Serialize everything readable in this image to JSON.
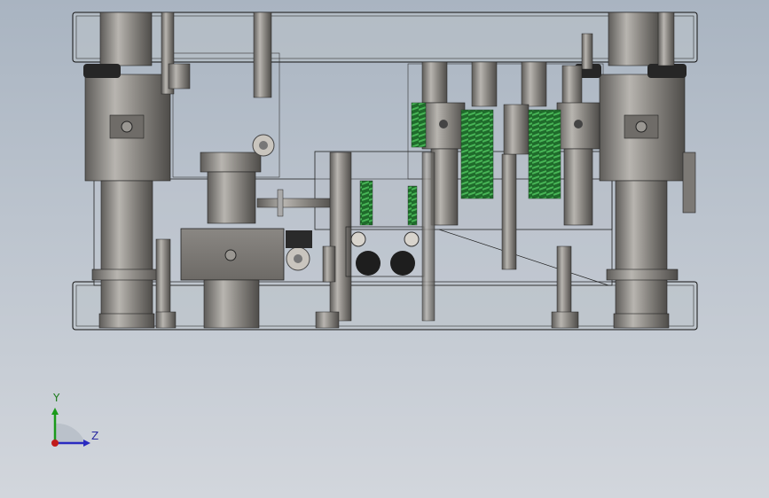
{
  "viewport": {
    "background_top": "#a9b4c1",
    "background_bottom": "#d2d6dc"
  },
  "triad": {
    "y_label": "Y",
    "z_label": "Z",
    "y_color": "#1a9a1a",
    "z_color": "#2a2ac0",
    "x_color": "#c01a1a"
  },
  "colors": {
    "steel": "#8c8a86",
    "steel_light": "#b5b2ad",
    "steel_dark": "#5e5c59",
    "spring": "#2e8a3a",
    "outline": "#1a1a1a",
    "glass": "#c4c9cf"
  }
}
